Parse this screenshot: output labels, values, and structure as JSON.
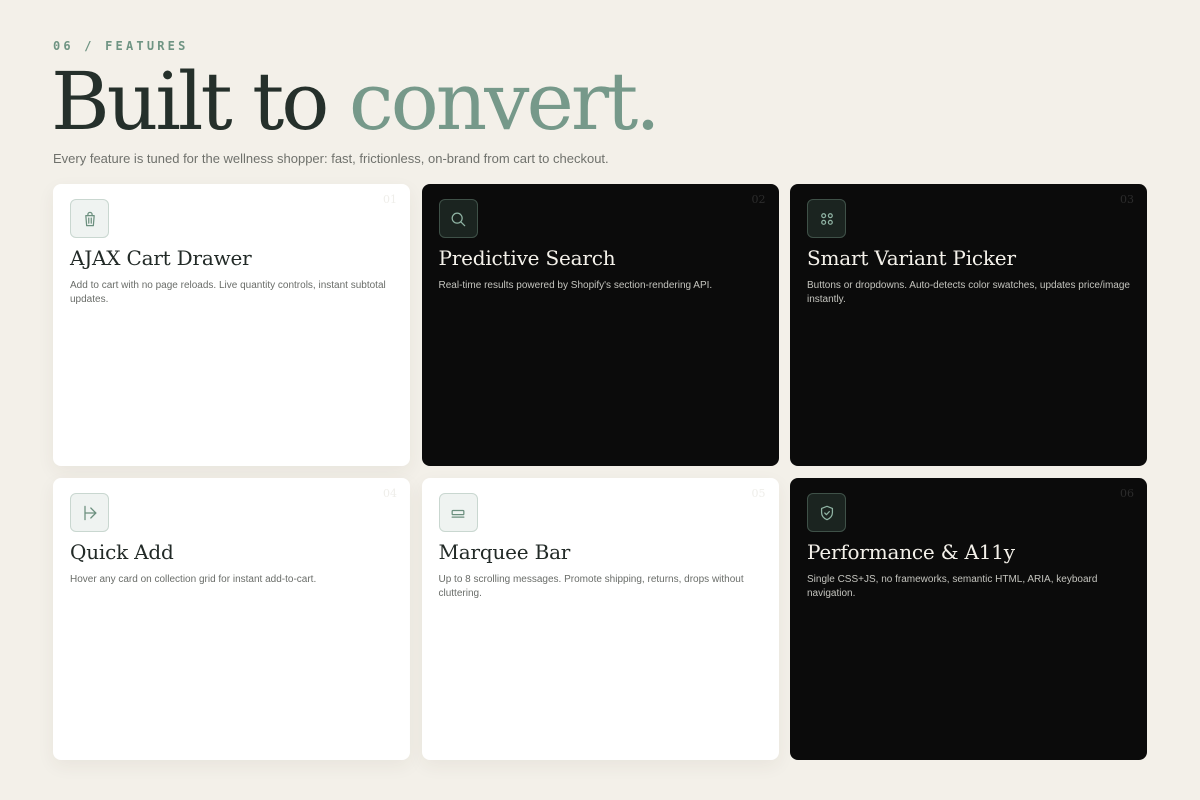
{
  "section": {
    "eyebrow": "06 / FEATURES",
    "headline_main": "Built to",
    "headline_accent": "convert.",
    "subtitle": "Every feature is tuned for the wellness shopper: fast, frictionless, on-brand from cart to checkout."
  },
  "colors": {
    "background": "#f3f0e9",
    "accent": "#76998a",
    "dark_card": "#0b0b0b",
    "light_card": "#ffffff"
  },
  "features": [
    {
      "number": "01",
      "icon": "shopping-bag-icon",
      "theme": "light",
      "title": "AJAX Cart Drawer",
      "description": "Add to cart with no page reloads. Live quantity controls, instant subtotal updates."
    },
    {
      "number": "02",
      "icon": "search-icon",
      "theme": "dark",
      "title": "Predictive Search",
      "description": "Real-time results powered by Shopify's section-rendering API."
    },
    {
      "number": "03",
      "icon": "swatches-icon",
      "theme": "dark",
      "title": "Smart Variant Picker",
      "description": "Buttons or dropdowns. Auto-detects color swatches, updates price/image instantly."
    },
    {
      "number": "04",
      "icon": "arrow-to-bar-icon",
      "theme": "light",
      "title": "Quick Add",
      "description": "Hover any card on collection grid for instant add-to-cart."
    },
    {
      "number": "05",
      "icon": "marquee-bar-icon",
      "theme": "light",
      "title": "Marquee Bar",
      "description": "Up to 8 scrolling messages. Promote shipping, returns, drops without cluttering."
    },
    {
      "number": "06",
      "icon": "shield-check-icon",
      "theme": "dark",
      "title": "Performance & A11y",
      "description": "Single CSS+JS, no frameworks, semantic HTML, ARIA, keyboard navigation."
    }
  ]
}
